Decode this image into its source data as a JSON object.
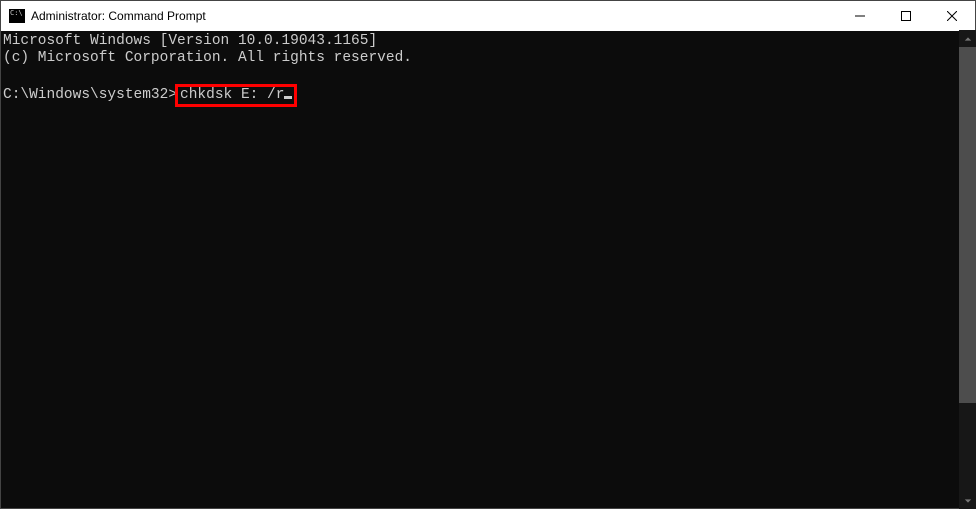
{
  "window": {
    "title": "Administrator: Command Prompt"
  },
  "terminal": {
    "line1": "Microsoft Windows [Version 10.0.19043.1165]",
    "line2": "(c) Microsoft Corporation. All rights reserved.",
    "prompt_path": "C:\\Windows\\system32>",
    "command": "chkdsk E: /r"
  }
}
